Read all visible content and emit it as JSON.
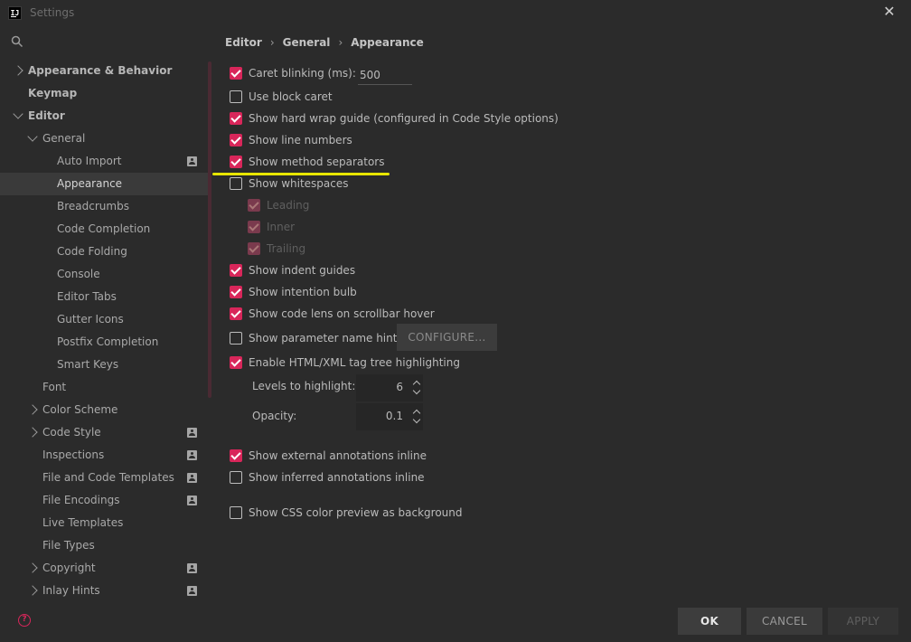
{
  "window": {
    "title": "Settings",
    "app_icon": "IJ"
  },
  "search": {
    "placeholder": ""
  },
  "sidebar": {
    "items": [
      {
        "label": "Appearance & Behavior",
        "level": 0,
        "bold": true,
        "chevron": "right",
        "profile": false
      },
      {
        "label": "Keymap",
        "level": 0,
        "bold": true,
        "chevron": "",
        "profile": false
      },
      {
        "label": "Editor",
        "level": 0,
        "bold": true,
        "chevron": "down",
        "profile": false
      },
      {
        "label": "General",
        "level": 1,
        "bold": false,
        "chevron": "down",
        "profile": false
      },
      {
        "label": "Auto Import",
        "level": 2,
        "bold": false,
        "chevron": "",
        "profile": true
      },
      {
        "label": "Appearance",
        "level": 2,
        "bold": false,
        "chevron": "",
        "profile": false,
        "selected": true
      },
      {
        "label": "Breadcrumbs",
        "level": 2,
        "bold": false,
        "chevron": "",
        "profile": false
      },
      {
        "label": "Code Completion",
        "level": 2,
        "bold": false,
        "chevron": "",
        "profile": false
      },
      {
        "label": "Code Folding",
        "level": 2,
        "bold": false,
        "chevron": "",
        "profile": false
      },
      {
        "label": "Console",
        "level": 2,
        "bold": false,
        "chevron": "",
        "profile": false
      },
      {
        "label": "Editor Tabs",
        "level": 2,
        "bold": false,
        "chevron": "",
        "profile": false
      },
      {
        "label": "Gutter Icons",
        "level": 2,
        "bold": false,
        "chevron": "",
        "profile": false
      },
      {
        "label": "Postfix Completion",
        "level": 2,
        "bold": false,
        "chevron": "",
        "profile": false
      },
      {
        "label": "Smart Keys",
        "level": 2,
        "bold": false,
        "chevron": "",
        "profile": false
      },
      {
        "label": "Font",
        "level": 1,
        "bold": false,
        "chevron": "",
        "profile": false
      },
      {
        "label": "Color Scheme",
        "level": 1,
        "bold": false,
        "chevron": "right",
        "profile": false
      },
      {
        "label": "Code Style",
        "level": 1,
        "bold": false,
        "chevron": "right",
        "profile": true
      },
      {
        "label": "Inspections",
        "level": 1,
        "bold": false,
        "chevron": "",
        "profile": true
      },
      {
        "label": "File and Code Templates",
        "level": 1,
        "bold": false,
        "chevron": "",
        "profile": true
      },
      {
        "label": "File Encodings",
        "level": 1,
        "bold": false,
        "chevron": "",
        "profile": true
      },
      {
        "label": "Live Templates",
        "level": 1,
        "bold": false,
        "chevron": "",
        "profile": false
      },
      {
        "label": "File Types",
        "level": 1,
        "bold": false,
        "chevron": "",
        "profile": false
      },
      {
        "label": "Copyright",
        "level": 1,
        "bold": false,
        "chevron": "right",
        "profile": true
      },
      {
        "label": "Inlay Hints",
        "level": 1,
        "bold": false,
        "chevron": "right",
        "profile": true
      }
    ]
  },
  "breadcrumb": [
    "Editor",
    "General",
    "Appearance"
  ],
  "options": {
    "caret_blinking": {
      "label": "Caret blinking (ms):",
      "checked": true,
      "value": "500"
    },
    "use_block_caret": {
      "label": "Use block caret",
      "checked": false
    },
    "hard_wrap": {
      "label": "Show hard wrap guide (configured in Code Style options)",
      "checked": true
    },
    "line_numbers": {
      "label": "Show line numbers",
      "checked": true
    },
    "method_separators": {
      "label": "Show method separators",
      "checked": true
    },
    "whitespaces": {
      "label": "Show whitespaces",
      "checked": false
    },
    "leading": {
      "label": "Leading",
      "checked": true,
      "disabled": true
    },
    "inner": {
      "label": "Inner",
      "checked": true,
      "disabled": true
    },
    "trailing": {
      "label": "Trailing",
      "checked": true,
      "disabled": true
    },
    "indent_guides": {
      "label": "Show indent guides",
      "checked": true
    },
    "intention_bulb": {
      "label": "Show intention bulb",
      "checked": true
    },
    "code_lens": {
      "label": "Show code lens on scrollbar hover",
      "checked": true
    },
    "param_hints": {
      "label": "Show parameter name hints",
      "checked": false
    },
    "html_tag_tree": {
      "label": "Enable HTML/XML tag tree highlighting",
      "checked": true
    },
    "external_annotations": {
      "label": "Show external annotations inline",
      "checked": true
    },
    "inferred_annotations": {
      "label": "Show inferred annotations inline",
      "checked": false
    },
    "css_color_preview": {
      "label": "Show CSS color preview as background",
      "checked": false
    }
  },
  "configure_label": "CONFIGURE...",
  "levels": {
    "label": "Levels to highlight:",
    "value": "6"
  },
  "opacity": {
    "label": "Opacity:",
    "value": "0.1"
  },
  "footer": {
    "ok": "OK",
    "cancel": "CANCEL",
    "apply": "APPLY",
    "help": "?"
  },
  "colors": {
    "accent": "#d8265a",
    "highlight": "#e8e600",
    "background": "#2b2b2b"
  }
}
